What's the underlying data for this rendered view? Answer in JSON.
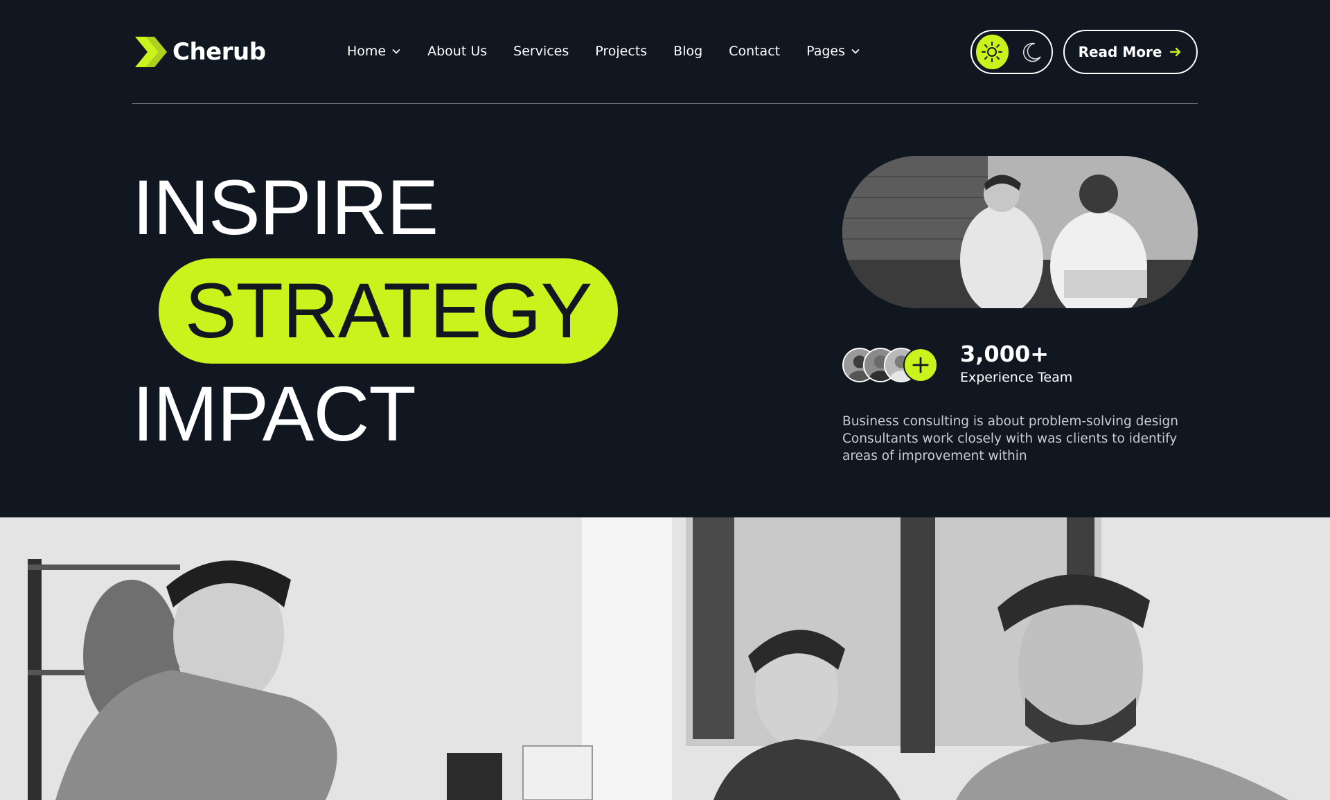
{
  "brand": {
    "name": "Cherub",
    "accent": "#c8f31d",
    "background": "#111720"
  },
  "nav": {
    "items": [
      {
        "label": "Home",
        "dropdown": true
      },
      {
        "label": "About Us",
        "dropdown": false
      },
      {
        "label": "Services",
        "dropdown": false
      },
      {
        "label": "Projects",
        "dropdown": false
      },
      {
        "label": "Blog",
        "dropdown": false
      },
      {
        "label": "Contact",
        "dropdown": false
      },
      {
        "label": "Pages",
        "dropdown": true
      }
    ]
  },
  "theme_toggle": {
    "active": "light",
    "icons": [
      "sun-icon",
      "moon-icon"
    ]
  },
  "cta": {
    "label": "Read More",
    "icon": "arrow-right-icon"
  },
  "hero": {
    "line1": "INSPIRE",
    "line2": "STRATEGY",
    "line3": "IMPACT"
  },
  "team_stat": {
    "number": "3,000+",
    "label": "Experience Team"
  },
  "description": "Business consulting is about problem-solving design Consultants work closely with was clients to identify areas of improvement within"
}
